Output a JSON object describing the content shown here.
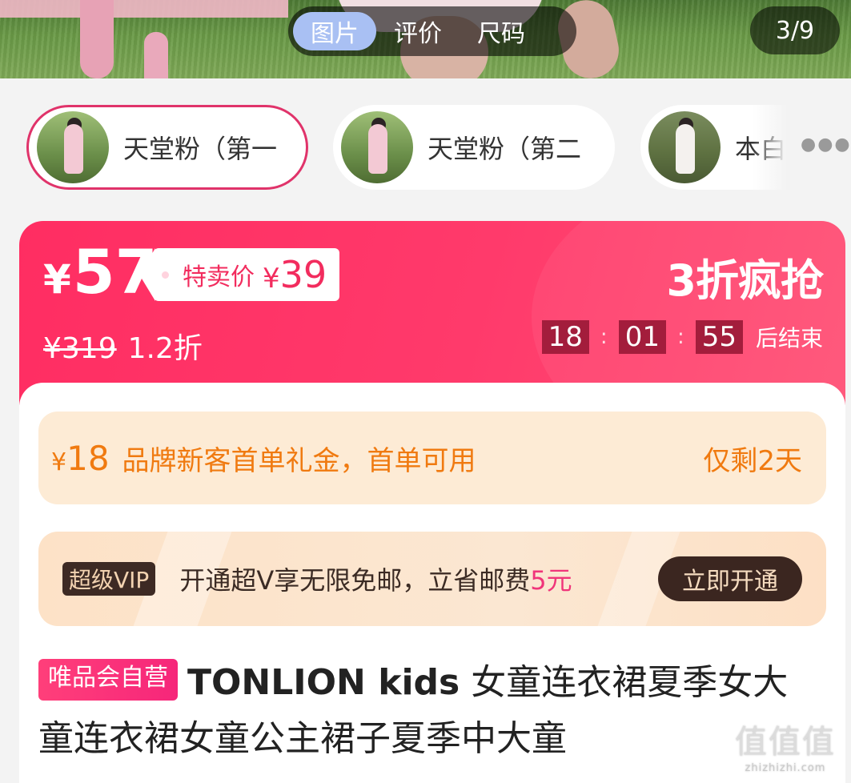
{
  "media": {
    "tabs": [
      {
        "label": "图片",
        "active": true
      },
      {
        "label": "评价",
        "active": false
      },
      {
        "label": "尺码",
        "active": false
      }
    ],
    "counter": "3/9"
  },
  "sku_options": [
    {
      "label": "天堂粉（第一",
      "selected": true
    },
    {
      "label": "天堂粉（第二",
      "selected": false
    },
    {
      "label": "本白",
      "selected": false
    }
  ],
  "price": {
    "currency": "¥",
    "current": "57",
    "special_label": "特卖价",
    "special_value": "39",
    "original": "¥319",
    "discount": "1.2折",
    "flash_title": "3折疯抢",
    "countdown": {
      "h": "18",
      "m": "01",
      "s": "55",
      "sep": ":",
      "suffix": "后结束"
    }
  },
  "coupon": {
    "amount": "18",
    "description": "品牌新客首单礼金，首单可用",
    "remaining": "仅剩2天"
  },
  "vip": {
    "badge": "超级VIP",
    "text": "开通超V享无限免邮，立省邮费",
    "highlight": "5元",
    "button": "立即开通"
  },
  "product": {
    "badge": "唯品会自营",
    "brand": "TONLION kids",
    "title_line1": "女童连衣裙夏季女大",
    "title_line2": "童连衣裙女童公主裙子夏季中大童"
  },
  "watermark": {
    "text": "值值值",
    "site": "zhizhizhi.com"
  },
  "colors": {
    "accent": "#ff2d62",
    "coupon_text": "#f07a10",
    "vip_dark": "#3b2620",
    "select_border": "#e0336a"
  }
}
